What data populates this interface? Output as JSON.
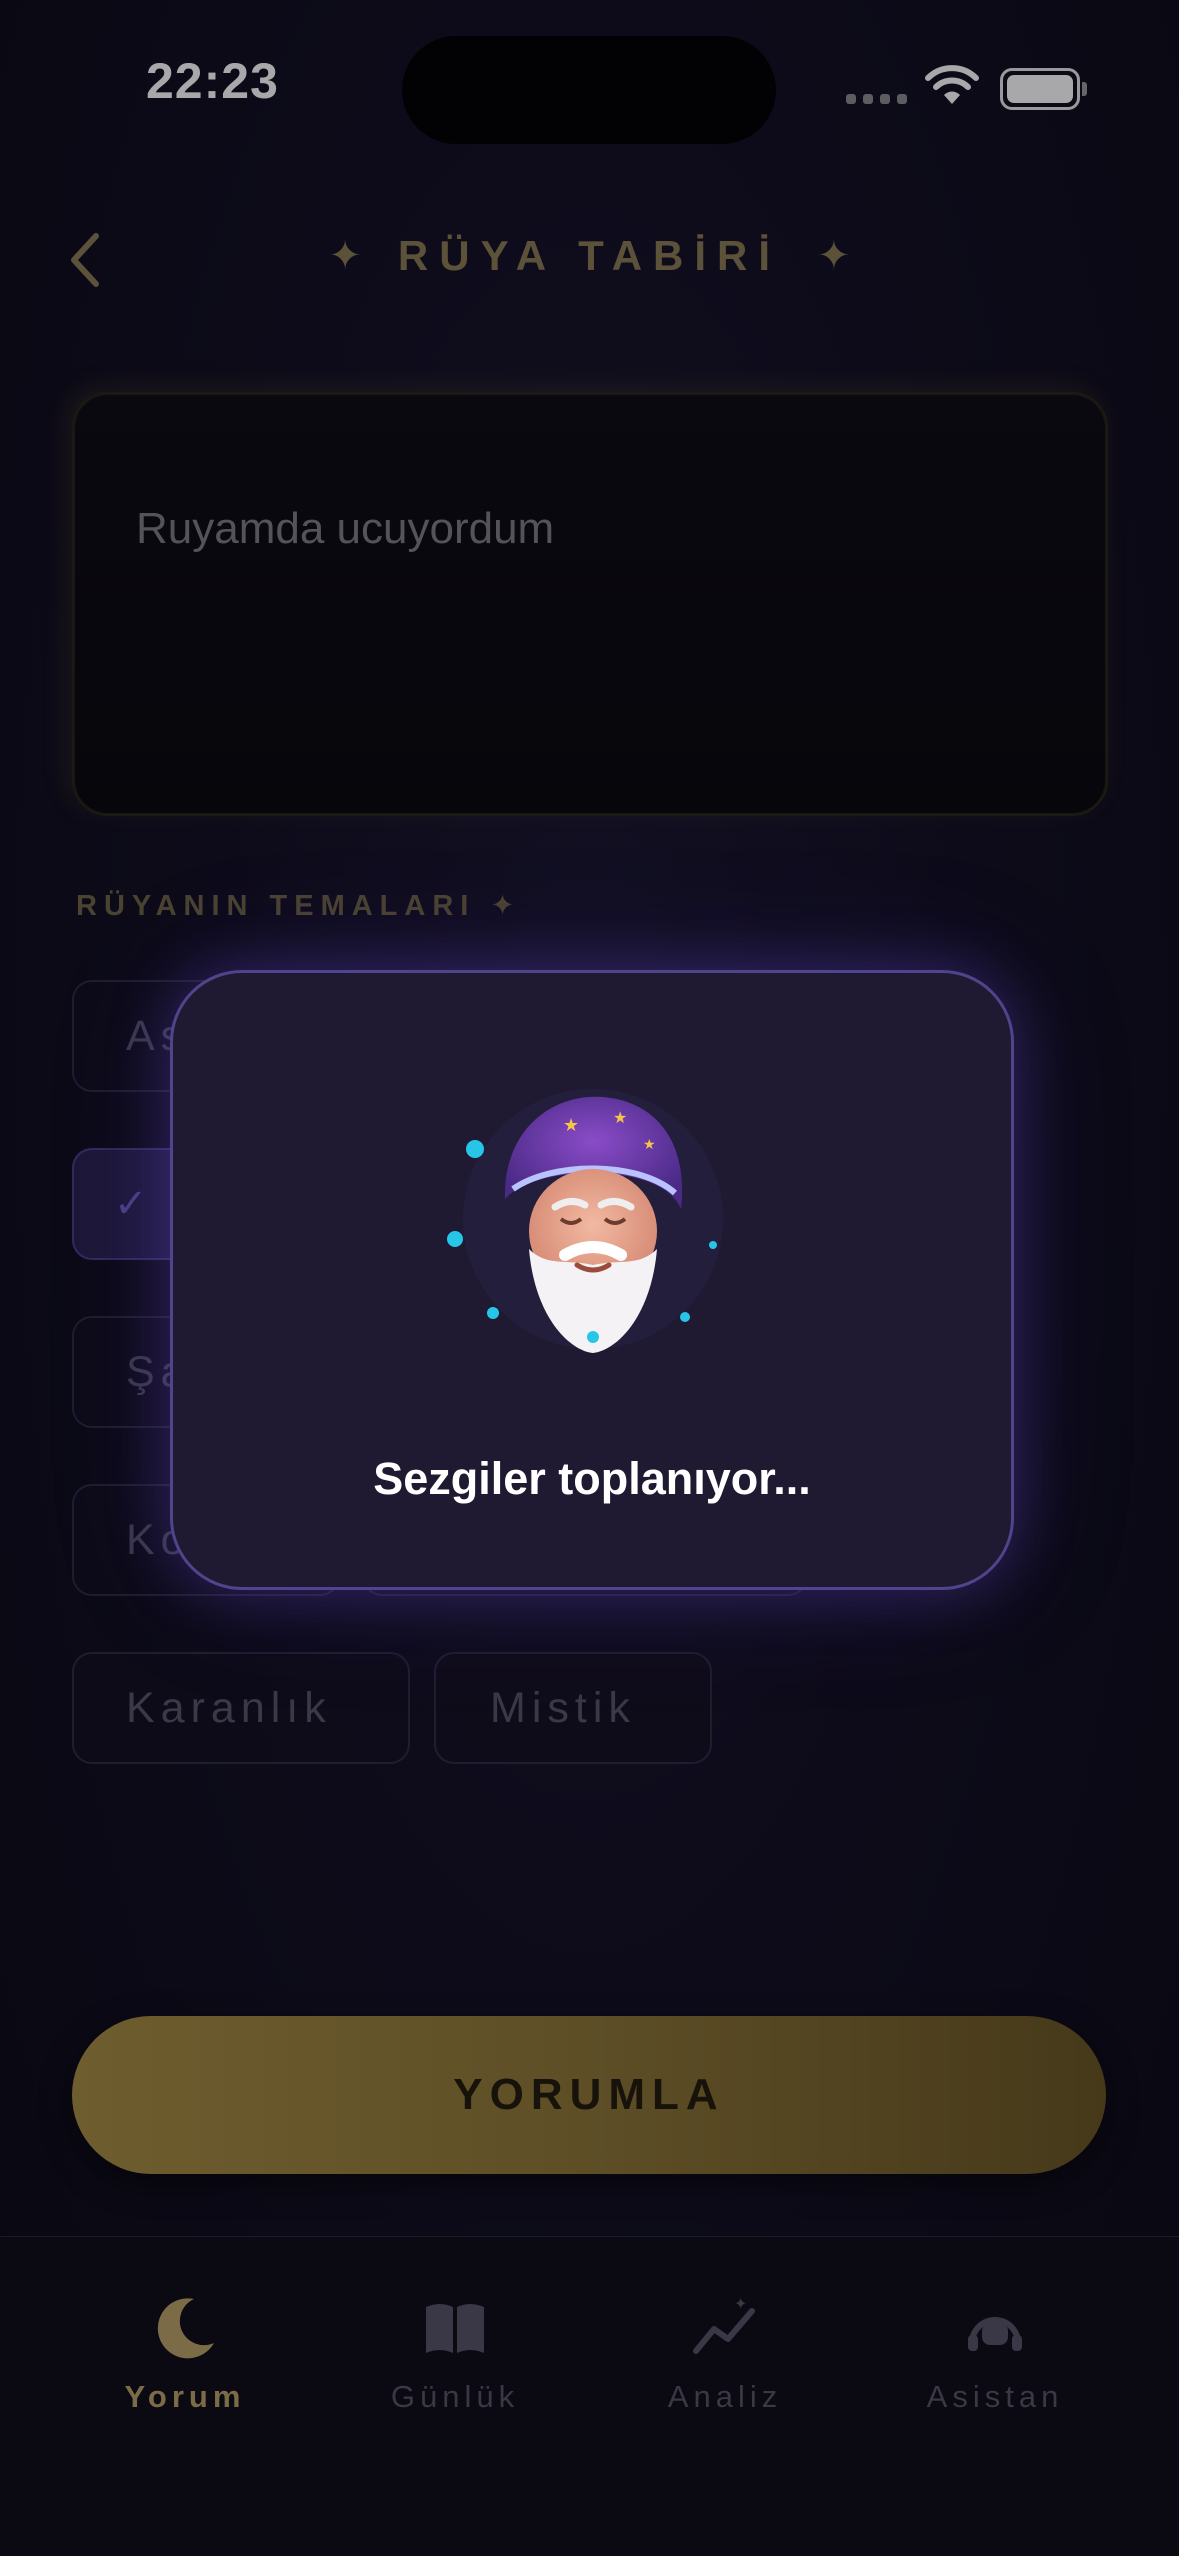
{
  "status_bar": {
    "time": "22:23"
  },
  "header": {
    "title": "RÜYA TABİRİ",
    "star": "✦"
  },
  "dream_input": {
    "value": "Ruyamda ucuyordum"
  },
  "themes": {
    "label": "RÜYANIN TEMALARI ✦",
    "chips": [
      {
        "label": "As",
        "selected": false
      },
      {
        "label": "",
        "selected": true
      },
      {
        "label": "Şa",
        "selected": false
      },
      {
        "label": "Ko",
        "selected": false
      },
      {
        "label": "Karanlık",
        "selected": false
      },
      {
        "label": "Mistik",
        "selected": false
      }
    ]
  },
  "loading_modal": {
    "message": "Sezgiler toplanıyor..."
  },
  "cta": {
    "label": "YORUMLA"
  },
  "tabbar": {
    "tabs": [
      {
        "label": "Yorum",
        "icon": "moon-icon",
        "active": true
      },
      {
        "label": "Günlük",
        "icon": "book-icon",
        "active": false
      },
      {
        "label": "Analiz",
        "icon": "chart-icon",
        "active": false
      },
      {
        "label": "Asistan",
        "icon": "assistant-icon",
        "active": false
      }
    ]
  },
  "colors": {
    "accent_gold": "#8a7a52",
    "modal_border": "#51438c",
    "background": "#0c0a16"
  }
}
